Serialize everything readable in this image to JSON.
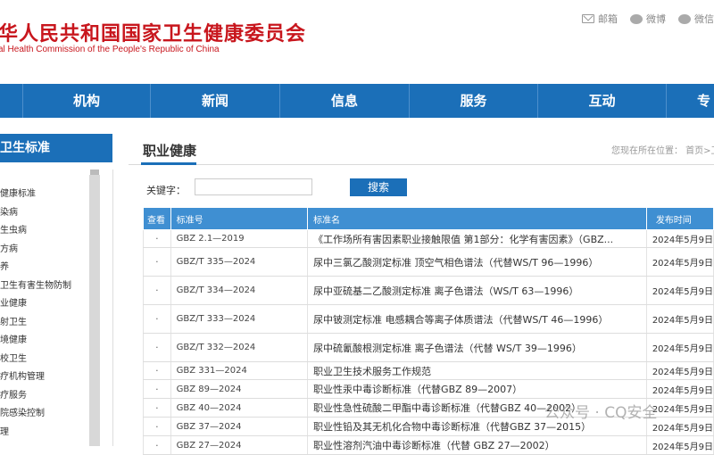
{
  "header": {
    "logo_cn": "华人民共和国国家卫生健康委员会",
    "logo_en": "al Health Commission of the People's Republic of China",
    "links": [
      {
        "label": "邮箱",
        "icon": "mail-icon"
      },
      {
        "label": "微博",
        "icon": "weibo-icon"
      },
      {
        "label": "微信",
        "icon": "wechat-icon"
      }
    ]
  },
  "nav": {
    "items": [
      "",
      "机构",
      "新闻",
      "信息",
      "服务",
      "互动",
      "专"
    ]
  },
  "sidebar": {
    "heading": "卫生标准",
    "items": [
      "健康标准",
      "染病",
      "生虫病",
      "方病",
      "养",
      "卫生有害生物防制",
      "业健康",
      "射卫生",
      "境健康",
      "校卫生",
      "疗机构管理",
      "疗服务",
      "院感染控制",
      "理"
    ]
  },
  "main": {
    "title": "职业健康",
    "breadcrumb": "您现在所在位置： 首页>卫",
    "search_label": "关键字：",
    "search_placeholder": "",
    "search_button": "搜索",
    "table": {
      "headers": [
        "查看",
        "标准号",
        "标准名",
        "发布时间"
      ],
      "rows": [
        {
          "view": "·",
          "code": "GBZ 2.1—2019",
          "name": "《工作场所有害因素职业接触限值 第1部分：化学有害因素》（GBZ...",
          "date": "2024年5月9日"
        },
        {
          "view": "·",
          "code": "GBZ/T 335—2024",
          "name": "尿中三氯乙酸测定标准 顶空气相色谱法（代替WS/T 96—1996）",
          "date": "2024年5月9日"
        },
        {
          "view": "·",
          "code": "GBZ/T 334—2024",
          "name": "尿中亚硫基二乙酸测定标准 离子色谱法（WS/T 63—1996）",
          "date": "2024年5月9日"
        },
        {
          "view": "·",
          "code": "GBZ/T 333—2024",
          "name": "尿中铍测定标准 电感耦合等离子体质谱法（代替WS/T 46—1996）",
          "date": "2024年5月9日"
        },
        {
          "view": "·",
          "code": "GBZ/T 332—2024",
          "name": "尿中硫氰酸根测定标准 离子色谱法（代替 WS/T 39—1996）",
          "date": "2024年5月9日"
        },
        {
          "view": "·",
          "code": "GBZ 331—2024",
          "name": "职业卫生技术服务工作规范",
          "date": "2024年5月9日"
        },
        {
          "view": "·",
          "code": "GBZ 89—2024",
          "name": "职业性汞中毒诊断标准（代替GBZ 89—2007）",
          "date": "2024年5月9日"
        },
        {
          "view": "·",
          "code": "GBZ 40—2024",
          "name": "职业性急性硫酸二甲酯中毒诊断标准（代替GBZ 40—2002）",
          "date": "2024年5月9日"
        },
        {
          "view": "·",
          "code": "GBZ 37—2024",
          "name": "职业性铅及其无机化合物中毒诊断标准（代替GBZ 37—2015）",
          "date": "2024年5月9日"
        },
        {
          "view": "·",
          "code": "GBZ 27—2024",
          "name": "职业性溶剂汽油中毒诊断标准（代替 GBZ 27—2002）",
          "date": "2024年5月9日"
        }
      ]
    }
  },
  "watermark": "公众号 · CQ安全",
  "colors": {
    "brand_red": "#c8161d",
    "nav_blue": "#1b6fb8",
    "table_head": "#3f8fd2"
  }
}
